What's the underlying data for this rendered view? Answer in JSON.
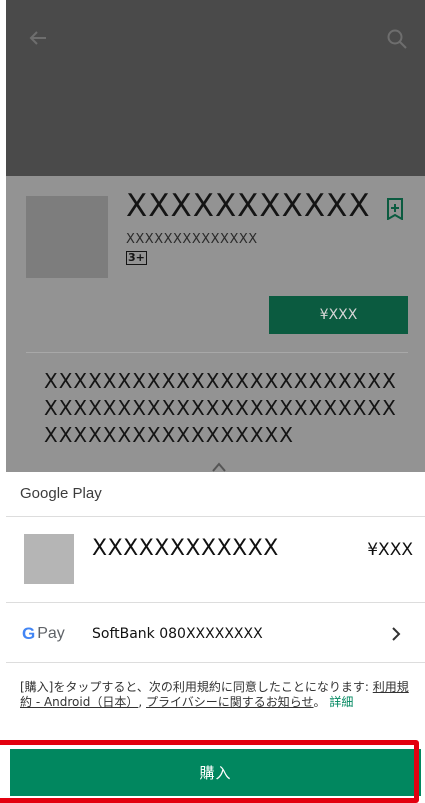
{
  "app": {
    "title": "XXXXXXXXXXX",
    "developer": "XXXXXXXXXXXXXX",
    "rating": "3+",
    "price": "¥XXX",
    "description": "XXXXXXXXXXXXXXXXXXXXXXXXXXXXXXXXXXXXXXXXXXXXXXXXXXXXXXXXXXXXXXXXX"
  },
  "sheet": {
    "title": "Google Play",
    "item_name": "XXXXXXXXXXXX",
    "item_price": "¥XXX",
    "gpay_g": "G",
    "gpay_pay": "Pay",
    "payment_method": "SoftBank 080XXXXXXXX",
    "terms_prefix": "[購入]をタップすると、次の利用規約に同意したことになります: ",
    "terms_link1": "利用規約 - Android（日本）",
    "terms_sep": ", ",
    "terms_link2": "プライバシーに関するお知らせ",
    "terms_period": "。",
    "terms_detail": "詳細",
    "buy_label": "購入"
  },
  "colors": {
    "accent": "#01875f",
    "highlight": "#e3000f"
  },
  "icons": {
    "back": "back-arrow-icon",
    "search": "search-icon",
    "wishlist": "wishlist-icon",
    "expand": "expand-icon",
    "chevron": "chevron-right-icon"
  }
}
